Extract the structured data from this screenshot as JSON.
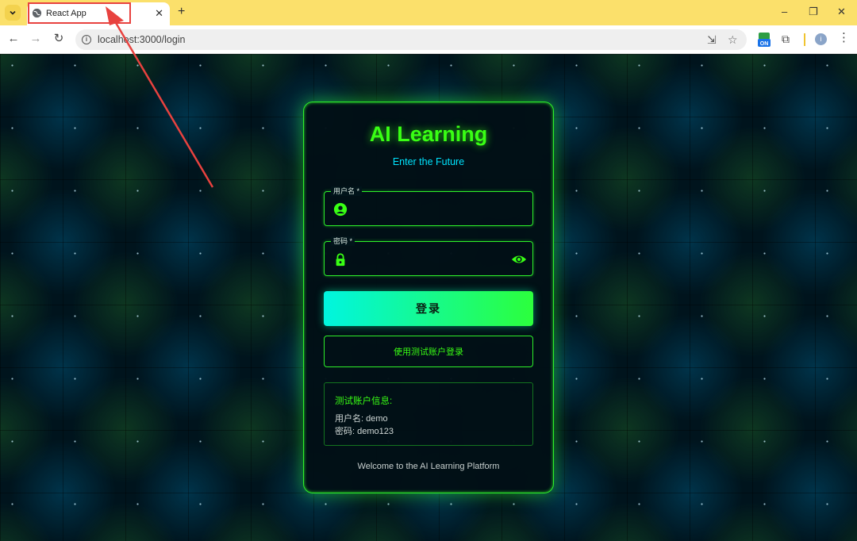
{
  "browser": {
    "tab_title": "React App",
    "new_tab": "+",
    "url": "localhost:3000/login",
    "window_controls": {
      "minimize": "–",
      "restore": "❐",
      "close": "✕"
    },
    "profile_initial": "i",
    "extension_badge": "ON"
  },
  "login": {
    "title": "AI Learning",
    "subtitle": "Enter the Future",
    "username_label": "用户名 *",
    "password_label": "密码 *",
    "login_button": "登录",
    "test_login_button": "使用测试账户登录",
    "test_info": {
      "heading": "测试账户信息:",
      "username_line": "用户名: demo",
      "password_line": "密码: demo123"
    },
    "footer": "Welcome to the AI Learning Platform"
  },
  "colors": {
    "neon_green": "#39ff14",
    "cyan": "#00e5ff",
    "tabbar": "#fbe06b",
    "annotation": "#e8423f"
  }
}
